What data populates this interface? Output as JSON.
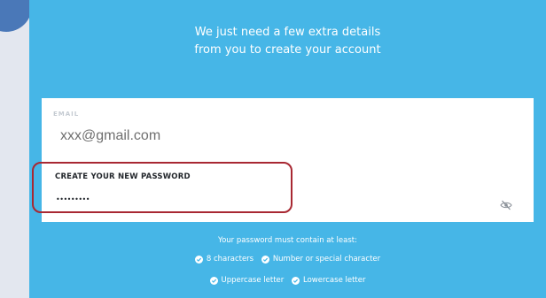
{
  "heading": {
    "line1": "We just need a few extra details",
    "line2": "from you to create your account"
  },
  "form": {
    "email_label": "EMAIL",
    "email_value": "xxx@gmail.com",
    "password_label": "CREATE YOUR NEW PASSWORD",
    "password_value": "•••••••••",
    "toggle_icon": "eye-slash-icon"
  },
  "requirements": {
    "title": "Your password must contain at least:",
    "items": [
      "8 characters",
      "Number or special character",
      "Uppercase letter",
      "Lowercase letter"
    ]
  },
  "colors": {
    "panel": "#46b6e7",
    "highlight": "#a82832",
    "badge": "#4a78b8"
  }
}
